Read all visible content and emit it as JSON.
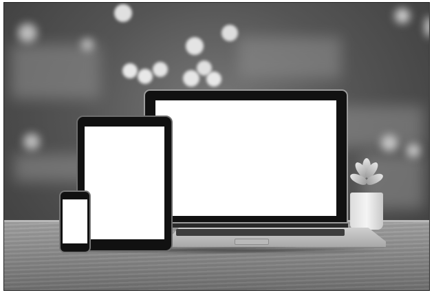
{
  "image": {
    "style": "grayscale",
    "scene": [
      "blurred-bokeh-background",
      "wooden-table",
      "laptop",
      "tablet",
      "smartphone",
      "succulent-plant"
    ]
  },
  "devices": {
    "laptop": {
      "screen": "blank-white"
    },
    "tablet": {
      "screen": "blank-white"
    },
    "phone": {
      "screen": "blank-white"
    }
  },
  "colors": {
    "screen": "#ffffff",
    "bezel": "#111111"
  }
}
